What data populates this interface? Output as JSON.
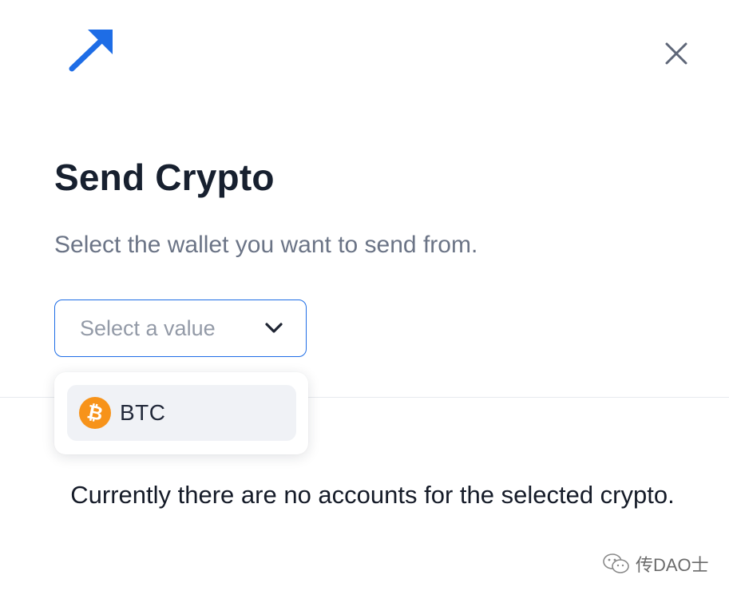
{
  "header": {
    "logo_icon": "arrow-up-right-icon",
    "close_icon": "close-icon",
    "accent_color": "#1e6de6"
  },
  "main": {
    "title": "Send Crypto",
    "subtitle": "Select the wallet you want to send from.",
    "select": {
      "placeholder": "Select a value",
      "icon": "chevron-down-icon"
    },
    "dropdown": {
      "options": [
        {
          "label": "BTC",
          "icon": "bitcoin-icon",
          "icon_color": "#f7931a"
        }
      ]
    },
    "empty_message": "Currently there are no accounts for the selected crypto."
  },
  "watermark": {
    "text": "传DAO士",
    "icon": "wechat-icon"
  }
}
